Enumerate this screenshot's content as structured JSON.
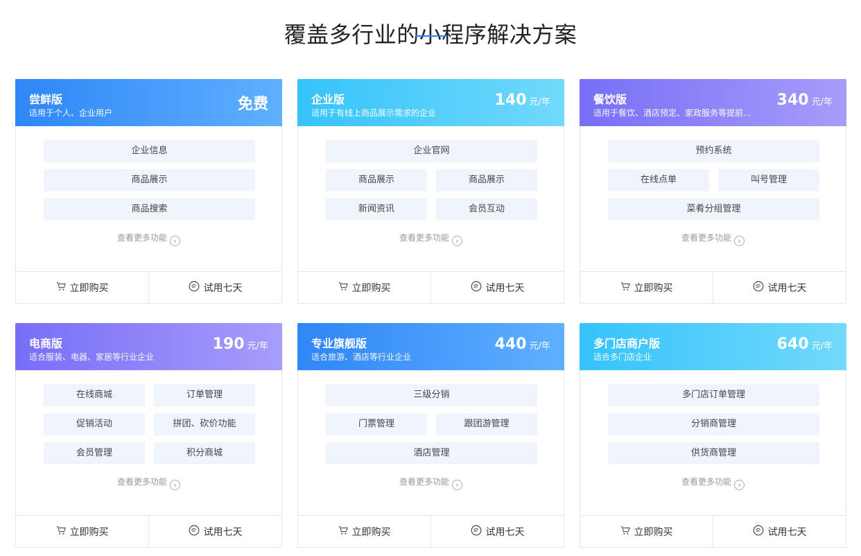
{
  "page": {
    "title": "覆盖多行业的小程序解决方案"
  },
  "common": {
    "more_label": "查看更多功能",
    "buy_label": "立即购买",
    "trial_label": "试用七天",
    "price_unit": "元/年"
  },
  "colors": {
    "accent": "#2f7cf6",
    "feature_bg": "#f0f4fc"
  },
  "plans": [
    {
      "name": "尝鲜版",
      "desc": "适用于个人、企业用户",
      "price": "免费",
      "unit": "",
      "gradient": [
        "#2f86f6",
        "#5fb0ff"
      ],
      "rows": [
        [
          "企业信息"
        ],
        [
          "商品展示"
        ],
        [
          "商品搜索"
        ]
      ]
    },
    {
      "name": "企业版",
      "desc": "适用于有线上商品展示需求的企业",
      "price": "140",
      "unit": "元/年",
      "gradient": [
        "#35c3fb",
        "#72d9fb"
      ],
      "rows": [
        [
          "企业官网"
        ],
        [
          "商品展示",
          "商品展示"
        ],
        [
          "新闻资讯",
          "会员互动"
        ]
      ]
    },
    {
      "name": "餐饮版",
      "desc": "适用于餐饮、酒店预定、家政服务等提前...",
      "price": "340",
      "unit": "元/年",
      "gradient": [
        "#786ef7",
        "#a69dfb"
      ],
      "rows": [
        [
          "预约系统"
        ],
        [
          "在线点单",
          "叫号管理"
        ],
        [
          "菜肴分组管理"
        ]
      ]
    },
    {
      "name": "电商版",
      "desc": "适合服装、电器、家居等行业企业",
      "price": "190",
      "unit": "元/年",
      "gradient": [
        "#786ef7",
        "#a69dfb"
      ],
      "rows": [
        [
          "在线商城",
          "订单管理"
        ],
        [
          "促销活动",
          "拼团、砍价功能"
        ],
        [
          "会员管理",
          "积分商城"
        ]
      ]
    },
    {
      "name": "专业旗舰版",
      "desc": "适合旅游、酒店等行业企业",
      "price": "440",
      "unit": "元/年",
      "gradient": [
        "#2f86f6",
        "#5fb0ff"
      ],
      "rows": [
        [
          "三级分销"
        ],
        [
          "门票管理",
          "跟团游管理"
        ],
        [
          "酒店管理"
        ]
      ]
    },
    {
      "name": "多门店商户版",
      "desc": "适合多门店企业",
      "price": "640",
      "unit": "元/年",
      "gradient": [
        "#35c3fb",
        "#72d9fb"
      ],
      "rows": [
        [
          "多门店订单管理"
        ],
        [
          "分销商管理"
        ],
        [
          "供货商管理"
        ]
      ]
    }
  ]
}
